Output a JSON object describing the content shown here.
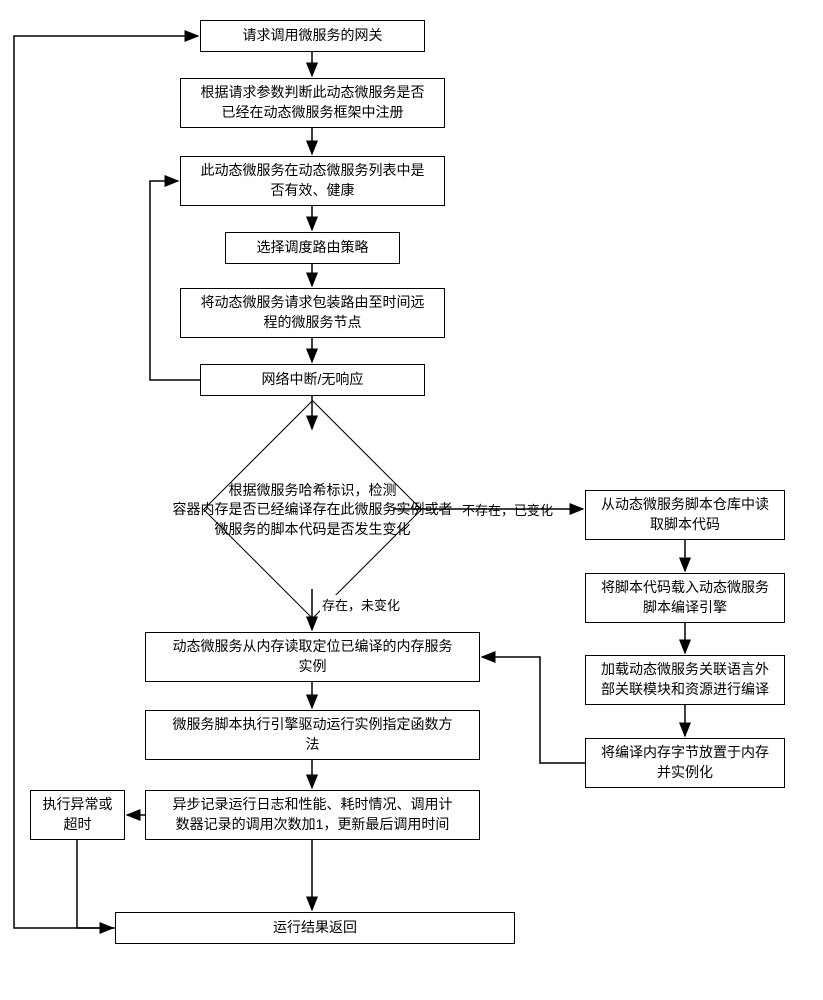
{
  "nodes": {
    "n1": "请求调用微服务的网关",
    "n2": "根据请求参数判断此动态微服务是否\n已经在动态微服务框架中注册",
    "n3": "此动态微服务在动态微服务列表中是\n否有效、健康",
    "n4": "选择调度路由策略",
    "n5": "将动态微服务请求包装路由至时间远\n程的微服务节点",
    "n6": "网络中断/无响应",
    "d1": "根据微服务哈希标识，检测\n容器内存是否已经编译存在此微服务实例或者\n微服务的脚本代码是否发生变化",
    "n7": "动态微服务从内存读取定位已编译的内存服务\n实例",
    "n8": "微服务脚本执行引擎驱动运行实例指定函数方\n法",
    "n9": "异步记录运行日志和性能、耗时情况、调用计\n数器记录的调用次数加1，更新最后调用时间",
    "n10": "执行异常或\n超时",
    "n11": "运行结果返回",
    "r1": "从动态微服务脚本仓库中读\n取脚本代码",
    "r2": "将脚本代码载入动态微服务\n脚本编译引擎",
    "r3": "加载动态微服务关联语言外\n部关联模块和资源进行编译",
    "r4": "将编译内存字节放置于内存\n并实例化"
  },
  "edges": {
    "right": "不存在，已变化",
    "down": "存在，未变化"
  }
}
